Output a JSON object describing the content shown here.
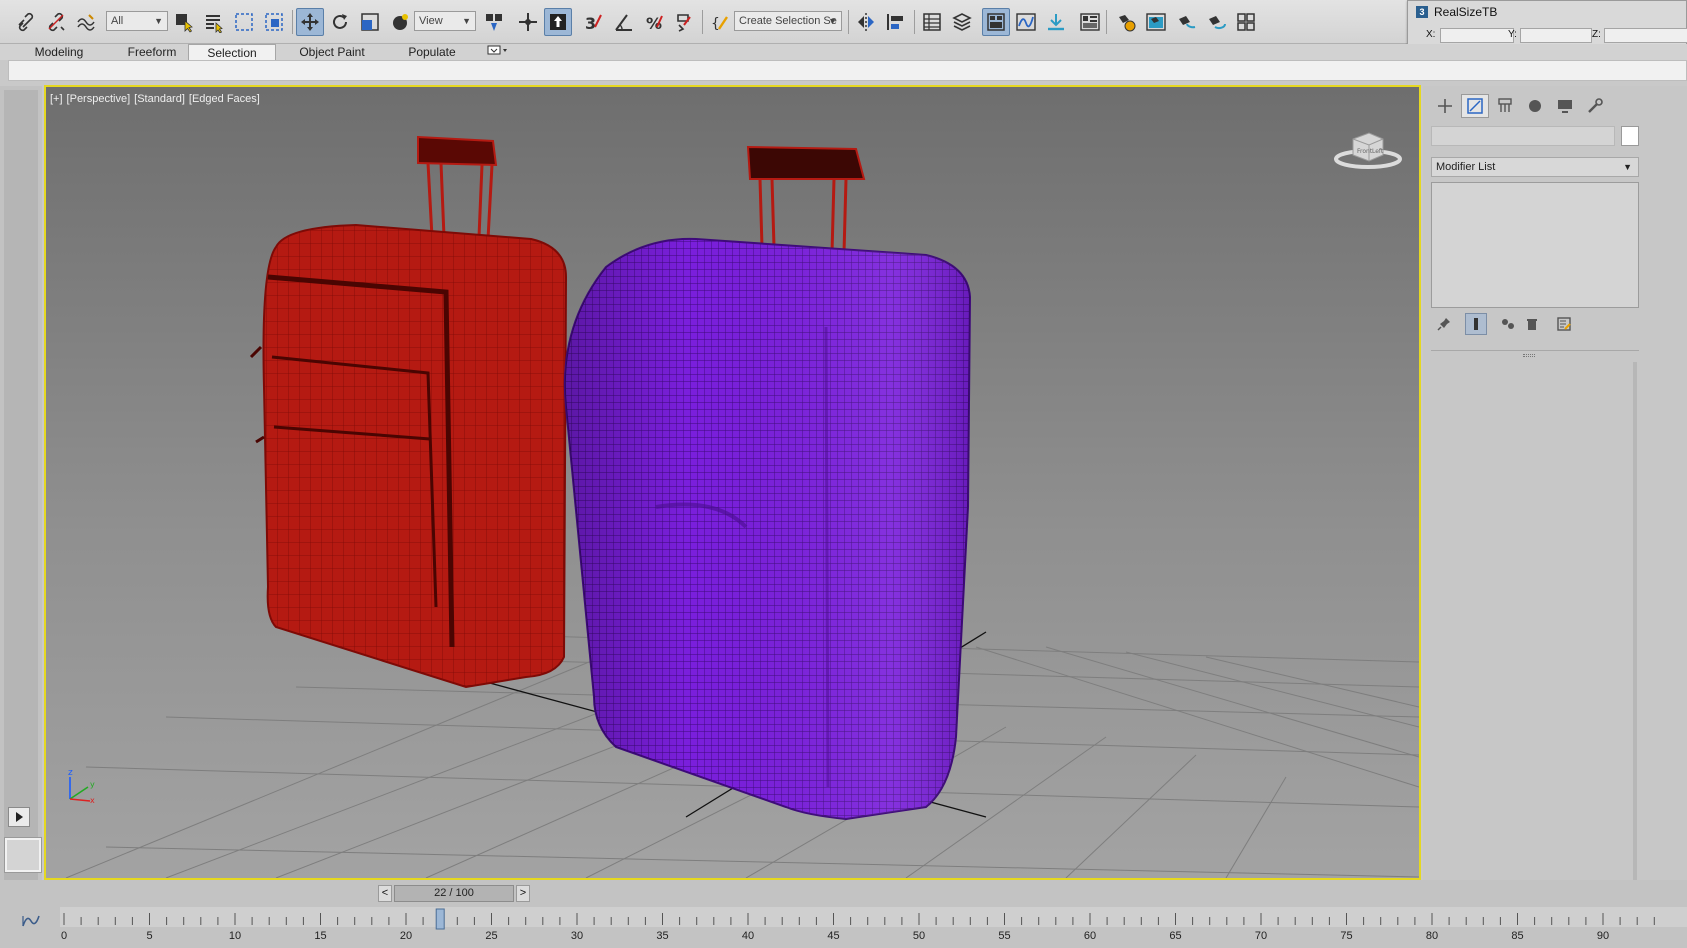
{
  "toolbar": {
    "selection_filter": "All",
    "ref_coord": "View",
    "named_selection_placeholder": "Create Selection Se"
  },
  "ribbon": {
    "tabs": [
      {
        "label": "Modeling",
        "active": false
      },
      {
        "label": "Freeform",
        "active": false
      },
      {
        "label": "Selection",
        "active": true
      },
      {
        "label": "Object Paint",
        "active": false
      },
      {
        "label": "Populate",
        "active": false
      }
    ]
  },
  "floating_window": {
    "title": "RealSizeTB",
    "app_icon_text": "3",
    "x_label": "X:",
    "y_label": "Y:",
    "z_label": "Z:"
  },
  "viewport": {
    "label_parts": [
      "[+]",
      "[Perspective]",
      "[Standard]",
      "[Edged Faces]"
    ],
    "viewcube_face_front": "Front",
    "viewcube_face_left": "Left",
    "objects": [
      {
        "name": "red-suitcase",
        "color": "#b51a12"
      },
      {
        "name": "purple-suitcase",
        "color": "#7a1fdc"
      }
    ],
    "highlight_border": "#e5d820"
  },
  "command_panel": {
    "modifier_list": "Modifier List",
    "object_color": "#ffffff"
  },
  "timeline": {
    "prev": "<",
    "next": ">",
    "frame_display": "22 / 100",
    "current_frame": 22,
    "total_frames": 100,
    "tick_labels": [
      "0",
      "5",
      "10",
      "15",
      "20",
      "25",
      "30",
      "35",
      "40",
      "45",
      "50",
      "55",
      "60",
      "65",
      "70",
      "75",
      "80",
      "85",
      "90"
    ]
  },
  "colors": {
    "accent_yellow": "#e5d820",
    "active_button": "#9cb7d6"
  }
}
